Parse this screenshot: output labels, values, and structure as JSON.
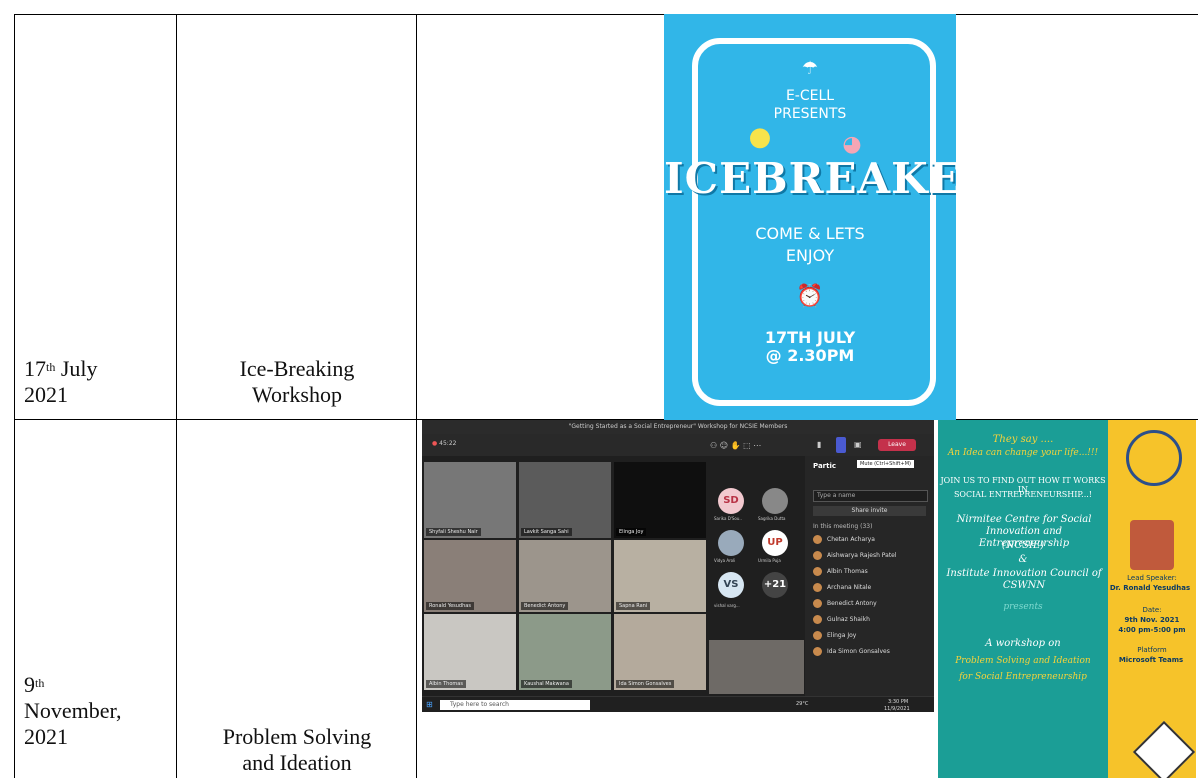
{
  "rows": [
    {
      "date_day": "17",
      "date_suffix": "th",
      "date_rest_1": " July",
      "date_rest_2": "2021",
      "title_line_1": "Ice-Breaking",
      "title_line_2": "Workshop"
    },
    {
      "date_day": "9",
      "date_suffix": "th",
      "date_rest_1": "November,",
      "date_rest_2": "2021",
      "title_line_1": "Problem Solving",
      "title_line_2": "and Ideation"
    }
  ],
  "poster_icebreaker": {
    "line1": "E-CELL",
    "line2": "PRESENTS",
    "headline": "ICEBREAKER",
    "line3": "COME & LETS",
    "line4": "ENJOY",
    "date": "17TH JULY",
    "time": "@ 2.30PM",
    "bg_color": "#31b6e8"
  },
  "teams_screenshot": {
    "window_title": "\"Getting Started as a Social Entrepreneur\" Workshop for NCSIE Members",
    "timer": "45:22",
    "leave_label": "Leave",
    "panel_title": "Partic",
    "tooltip": "Mute (Ctrl+Shift+M)",
    "search_placeholder": "Type a name",
    "share_label": "Share invite",
    "section_label": "In this meeting (33)",
    "participants": [
      "Chetan Acharya",
      "Aishwarya Rajesh Patel",
      "Albin Thomas",
      "Archana Nitale",
      "Benedict Antony",
      "Gulnaz Shaikh",
      "Elinga Joy",
      "Ida Simon Gonsalves"
    ],
    "tiles": [
      "Shyfali Sheshu Nair",
      "Lavkit Sanga Sahi",
      "Elinga Joy",
      "Ronald Yesudhas",
      "Benedict Antony",
      "Sapna Rani",
      "Albin Thomas",
      "Kaushal Makwana",
      "Ida Simon Gonsalves"
    ],
    "avatars": [
      {
        "initials": "SD",
        "color": "#f2c9cf",
        "text_color": "#b83245"
      },
      {
        "initials": "UP",
        "color": "#fff",
        "text_color": "#c0392b"
      },
      {
        "initials": "VS",
        "color": "#d7e6f2",
        "text_color": "#345"
      },
      {
        "initials": "+21",
        "color": "#444",
        "text_color": "#fff"
      }
    ],
    "avatar_labels": [
      "Sarika D'Sou..",
      "Sagrika Dutta",
      "Vidya Aroli",
      "Urmila Puja",
      "vishal varg..."
    ],
    "taskbar_search": "Type here to search",
    "taskbar_weather": "29°C",
    "taskbar_time": "3:30 PM",
    "taskbar_date": "11/9/2021"
  },
  "poster_ncsie": {
    "line1": "They say ....",
    "line2": "An Idea can change your life...!!!",
    "line3": "JOIN US TO FIND OUT HOW IT WORKS IN",
    "line4": "SOCIAL ENTREPRENEURSHIP...!",
    "org1": "Nirmitee Centre for Social Innovation and Entrepreneurship",
    "org1_abbr": "(NCSIE)",
    "amp": "&",
    "org2": "Institute Innovation Council of CSWNN",
    "presents": "presents",
    "line5": "A workshop on",
    "line6": "Problem Solving and Ideation",
    "line7": "for Social Entrepreneurship",
    "lead_label": "Lead Speaker:",
    "lead_name": "Dr. Ronald Yesudhas",
    "date_label": "Date:",
    "date_value": "9th Nov. 2021",
    "time_value": "4:00 pm-5:00 pm",
    "platform_label": "Platform",
    "platform_value": "Microsoft Teams"
  }
}
